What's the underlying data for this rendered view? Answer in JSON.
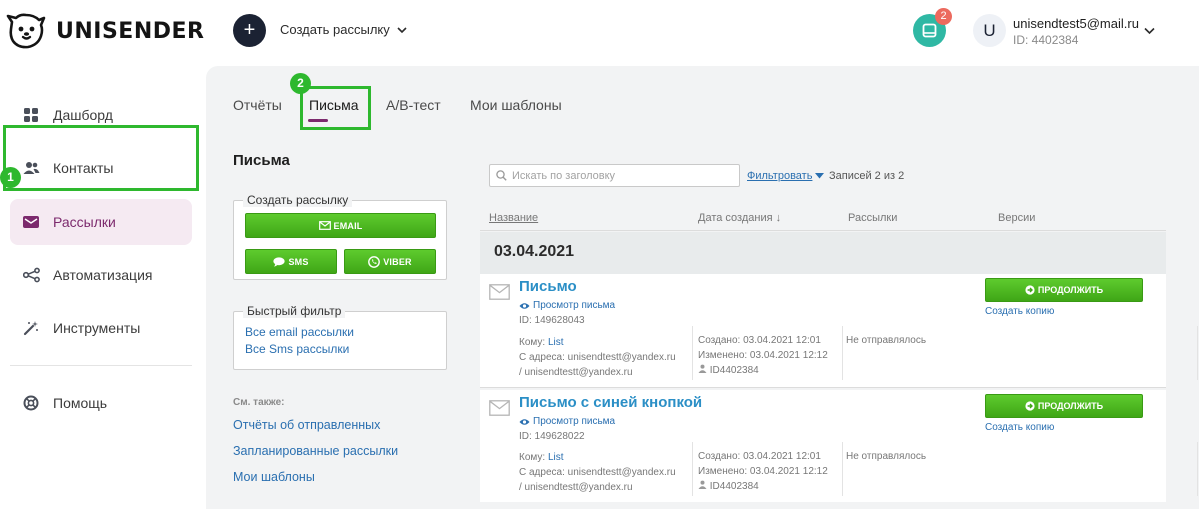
{
  "header": {
    "logo_text": "UNISENDER",
    "create_icon": "plus-icon",
    "create_label": "Создать рассылку",
    "notifications_count": "2",
    "avatar_letter": "U",
    "user_email": "unisendtest5@mail.ru",
    "user_id": "ID: 4402384"
  },
  "sidebar": {
    "items": [
      {
        "label": "Дашборд",
        "icon": "dashboard-grid-icon"
      },
      {
        "label": "Контакты",
        "icon": "contacts-people-icon"
      },
      {
        "label": "Рассылки",
        "icon": "mail-icon",
        "active": true
      },
      {
        "label": "Автоматизация",
        "icon": "automation-nodes-icon"
      },
      {
        "label": "Инструменты",
        "icon": "magic-wand-icon"
      },
      {
        "label": "Помощь",
        "icon": "help-lifebuoy-icon"
      }
    ]
  },
  "annotations": {
    "step1": "1",
    "step2": "2",
    "highlight_color": "#2eb82e"
  },
  "tabs": [
    {
      "label": "Отчёты"
    },
    {
      "label": "Письма",
      "active": true
    },
    {
      "label": "A/B-тест"
    },
    {
      "label": "Мои шаблоны"
    }
  ],
  "left_panel": {
    "title": "Письма",
    "create_group": {
      "legend": "Создать рассылку",
      "email_button": "EMAIL",
      "sms_button": "SMS",
      "viber_button": "VIBER"
    },
    "quick_filter": {
      "legend": "Быстрый фильтр",
      "links": [
        "Все email рассылки",
        "Все Sms рассылки"
      ]
    },
    "see_also_label": "См. также:",
    "see_also_links": [
      "Отчёты об отправленных",
      "Запланированные рассылки",
      "Мои шаблоны"
    ]
  },
  "list": {
    "search_placeholder": "Искать по заголовку",
    "filter_label": "Фильтровать",
    "records_label": "Записей 2 из 2",
    "columns": [
      "Название",
      "Дата создания ↓",
      "Рассылки",
      "Версии"
    ],
    "date_group": "03.04.2021",
    "rows": [
      {
        "title": "Письмо",
        "preview_label": "Просмотр письма",
        "id": "ID: 149628043",
        "to_label": "Кому:",
        "to_value": "List",
        "from_line1": "С адреса: unisendtestt@yandex.ru",
        "from_line2": "/ unisendtestt@yandex.ru",
        "created": "Создано: 03.04.2021 12:01",
        "modified": "Изменено: 03.04.2021 12:12",
        "author_id": "ID4402384",
        "status": "Не отправлялось",
        "continue_button": "ПРОДОЛЖИТЬ",
        "copy_link": "Создать копию"
      },
      {
        "title": "Письмо с синей кнопкой",
        "preview_label": "Просмотр письма",
        "id": "ID: 149628022",
        "to_label": "Кому:",
        "to_value": "List",
        "from_line1": "С адреса: unisendtestt@yandex.ru",
        "from_line2": "/ unisendtestt@yandex.ru",
        "created": "Создано: 03.04.2021 12:01",
        "modified": "Изменено: 03.04.2021 12:12",
        "author_id": "ID4402384",
        "status": "Не отправлялось",
        "continue_button": "ПРОДОЛЖИТЬ",
        "copy_link": "Создать копию"
      }
    ]
  },
  "colors": {
    "accent": "#7c2a6d",
    "green_button": "#4cb81f",
    "link": "#2a6fb0",
    "title_link": "#2b8fc6"
  }
}
